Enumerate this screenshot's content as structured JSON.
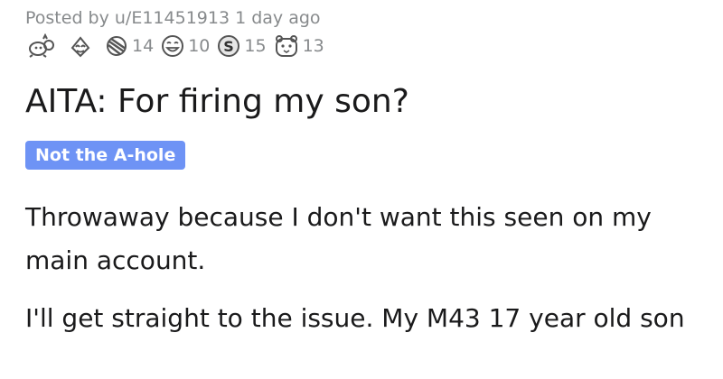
{
  "post": {
    "posted_by_prefix": "Posted by ",
    "username": "u/E11451913",
    "age": " 1 day ago",
    "title": "AITA: For firing my son?",
    "flair": "Not the A-hole",
    "paragraphs": [
      "Throwaway because I don't want this seen on my",
      "main account.",
      "I'll get straight to the issue. My M43 17 year old son"
    ]
  },
  "awards": [
    {
      "icon": "wholesome-seal-icon",
      "count": ""
    },
    {
      "icon": "heart-eyes-icon",
      "count": ""
    },
    {
      "icon": "facepalm-icon",
      "count": "14"
    },
    {
      "icon": "crying-laugh-icon",
      "count": "10"
    },
    {
      "icon": "money-bag-icon",
      "count": "15"
    },
    {
      "icon": "hamster-icon",
      "count": "13"
    }
  ],
  "colors": {
    "meta": "#878a8c",
    "text": "#1a1a1b",
    "flair_bg": "#6e93f5",
    "flair_text": "#ffffff"
  }
}
